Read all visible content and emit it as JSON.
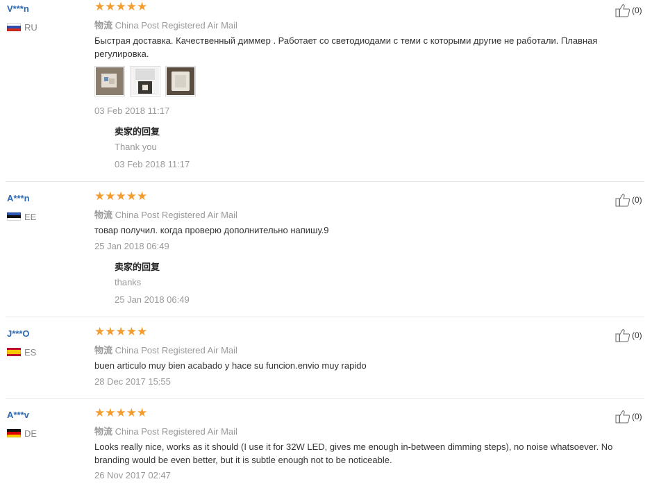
{
  "reviews": [
    {
      "user": "V***n",
      "country": "RU",
      "logistics_label": "物流",
      "logistics_value": "China Post Registered Air Mail",
      "text": "Быстрая доставка. Качественный диммер . Работает со светодиодами с теми с которыми другие не работали. Плавная регулировка.",
      "date": "03 Feb 2018 11:17",
      "helpful": "(0)",
      "reply": {
        "title": "卖家的回复",
        "text": "Thank you",
        "date": "03 Feb 2018 11:17"
      }
    },
    {
      "user": "A***n",
      "country": "EE",
      "logistics_label": "物流",
      "logistics_value": "China Post Registered Air Mail",
      "text": "товар получил. когда проверю дополнительно напишу.9",
      "date": "25 Jan 2018 06:49",
      "helpful": "(0)",
      "reply": {
        "title": "卖家的回复",
        "text": "thanks",
        "date": "25 Jan 2018 06:49"
      }
    },
    {
      "user": "J***O",
      "country": "ES",
      "logistics_label": "物流",
      "logistics_value": "China Post Registered Air Mail",
      "text": "buen articulo muy bien acabado y hace su funcion.envio muy rapido",
      "date": "28 Dec 2017 15:55",
      "helpful": "(0)"
    },
    {
      "user": "A***v",
      "country": "DE",
      "logistics_label": "物流",
      "logistics_value": "China Post Registered Air Mail",
      "text": "Looks really nice, works as it should (I use it for 32W LED, gives me enough in-between dimming steps), no noise whatsoever. No branding would be even better, but it is subtle enough not to be noticeable.",
      "date": "26 Nov 2017 02:47",
      "helpful": "(0)"
    }
  ],
  "colors": {
    "star": "#f39c2f",
    "username": "#2d6ab3",
    "muted": "#999999"
  }
}
